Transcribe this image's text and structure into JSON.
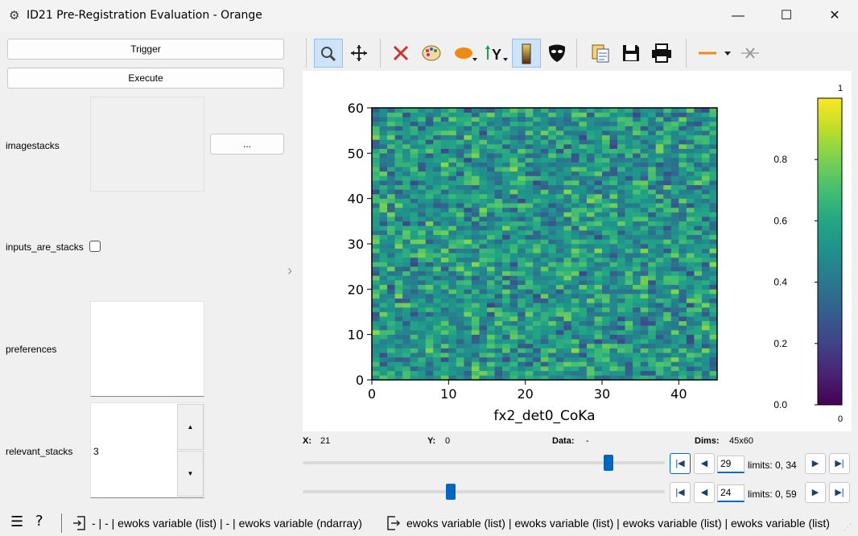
{
  "window": {
    "title": "ID21 Pre-Registration Evaluation - Orange",
    "app_icon": "gear-icon",
    "minimize": "—",
    "maximize": "☐",
    "close": "✕"
  },
  "left": {
    "trigger_label": "Trigger",
    "execute_label": "Execute",
    "imagestacks_label": "imagestacks",
    "browse_label": "...",
    "inputs_are_stacks_label": "inputs_are_stacks",
    "inputs_are_stacks_checked": false,
    "preferences_label": "preferences",
    "relevant_stacks_label": "relevant_stacks",
    "relevant_stacks_value": "3",
    "spin_up": "▲",
    "spin_down": "▼"
  },
  "toolbar": {
    "icons": [
      "zoom-icon",
      "pan-icon",
      "reset-zoom-icon",
      "colormap-icon",
      "aspect-ratio-icon",
      "y-axis-icon",
      "keep-aspect-icon",
      "mask-icon",
      "copy-icon",
      "save-icon",
      "print-icon",
      "line-style-icon",
      "clear-icon"
    ]
  },
  "chart_data": {
    "type": "heatmap",
    "title": "",
    "xlabel": "fx2_det0_CoKa",
    "ylabel": "",
    "xlim": [
      0,
      45
    ],
    "ylim": [
      0,
      60
    ],
    "x_ticks": [
      "0",
      "10",
      "20",
      "30",
      "40"
    ],
    "y_ticks": [
      "0",
      "10",
      "20",
      "30",
      "40",
      "50",
      "60"
    ],
    "colorbar_ticks": [
      "0.0",
      "0.2",
      "0.4",
      "0.6",
      "0.8"
    ],
    "colorbar_min": "0",
    "colorbar_max": "1",
    "colormap": "viridis",
    "value_range": [
      0.2,
      0.85
    ]
  },
  "status": {
    "x_label": "X:",
    "x_value": "21",
    "y_label": "Y:",
    "y_value": "0",
    "data_label": "Data:",
    "data_value": "-",
    "dims_label": "Dims:",
    "dims_value": "45x60"
  },
  "sliders": [
    {
      "value": "29",
      "limits": "limits: 0, 34",
      "fraction": 0.853
    },
    {
      "value": "24",
      "limits": "limits: 0, 59",
      "fraction": 0.407
    }
  ],
  "bottom": {
    "inputs_text": "- | - | ewoks variable (list) | - | ewoks variable (ndarray)",
    "outputs_text": "ewoks variable (list) | ewoks variable (list) | ewoks variable (list) | ewoks variable (list)",
    "colors": {
      "accent": "#0067c0"
    }
  }
}
